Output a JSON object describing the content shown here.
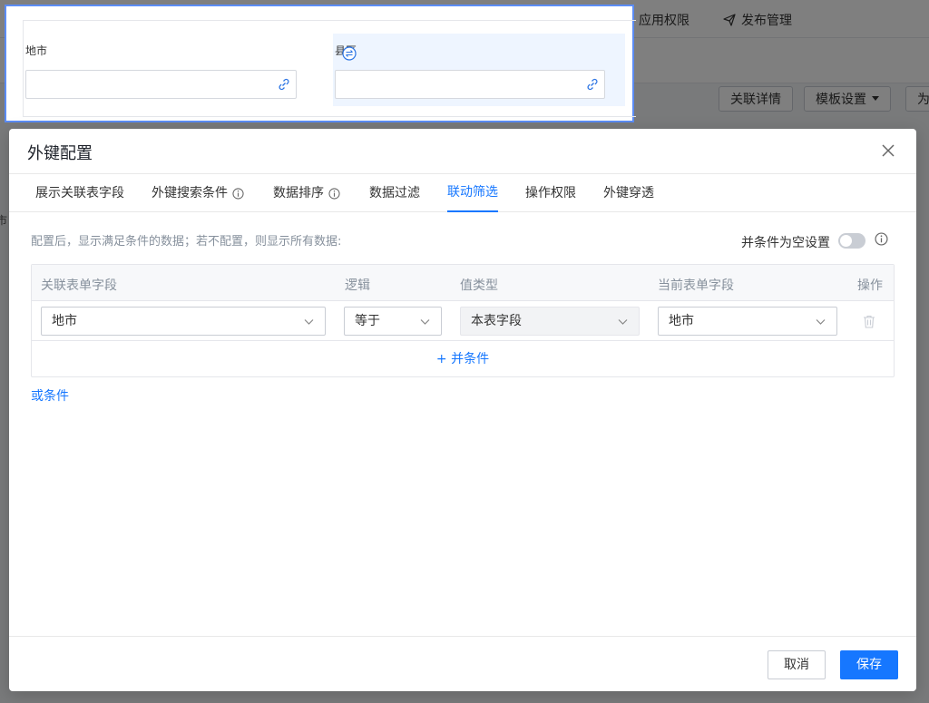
{
  "background": {
    "nav_items": [
      {
        "label": "应用权限",
        "icon": "lock-icon"
      },
      {
        "label": "发布管理",
        "icon": "send-icon"
      }
    ],
    "toolbar_buttons": [
      "关联详情",
      "模板设置",
      "为"
    ],
    "side_label": "市"
  },
  "preview": {
    "field_left": {
      "label": "地市",
      "icon": "link-icon"
    },
    "field_right": {
      "label": "县区",
      "icon": "link-icon"
    },
    "swap_icon": "swap-icon"
  },
  "modal": {
    "title": "外键配置",
    "tabs": [
      {
        "label": "展示关联表字段",
        "info": false,
        "active": false
      },
      {
        "label": "外键搜索条件",
        "info": true,
        "active": false
      },
      {
        "label": "数据排序",
        "info": true,
        "active": false
      },
      {
        "label": "数据过滤",
        "info": false,
        "active": false
      },
      {
        "label": "联动筛选",
        "info": false,
        "active": true
      },
      {
        "label": "操作权限",
        "info": false,
        "active": false
      },
      {
        "label": "外键穿透",
        "info": false,
        "active": false
      }
    ],
    "description": "配置后，显示满足条件的数据；若不配置，则显示所有数据:",
    "toggle_label": "并条件为空设置",
    "toggle_on": false,
    "table": {
      "headers": [
        "关联表单字段",
        "逻辑",
        "值类型",
        "当前表单字段",
        "操作"
      ],
      "rows": [
        {
          "related_field": "地市",
          "logic": "等于",
          "value_type": "本表字段",
          "current_field": "地市"
        }
      ],
      "add_and_label": "+ 并条件"
    },
    "add_or_label": "或条件",
    "cancel_label": "取消",
    "save_label": "保存"
  },
  "colors": {
    "primary": "#1677ff",
    "overlay": "rgba(0,0,0,0.5)",
    "highlight_border": "#5b8cf5"
  }
}
